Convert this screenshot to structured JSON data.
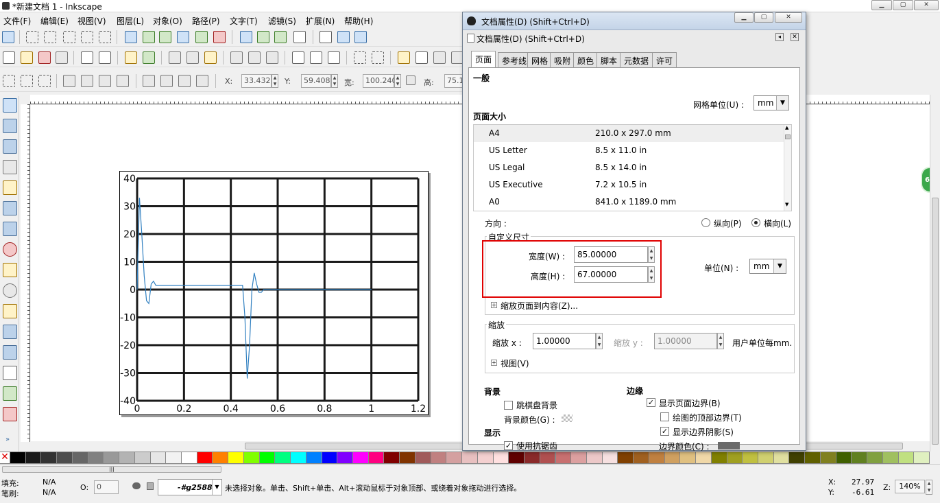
{
  "window": {
    "title": "*新建文档 1 - Inkscape"
  },
  "menubar": [
    "文件(F)",
    "编辑(E)",
    "视图(V)",
    "图层(L)",
    "对象(O)",
    "路径(P)",
    "文字(T)",
    "滤镜(S)",
    "扩展(N)",
    "帮助(H)"
  ],
  "coords_toolbar": {
    "x_label": "X:",
    "x_value": "33.432",
    "y_label": "Y:",
    "y_value": "59.408",
    "w_label": "宽:",
    "w_value": "100.240",
    "h_label": "高:",
    "h_value": "75.1"
  },
  "canvas_chart": {
    "chart_data": {
      "type": "line",
      "title": "",
      "xlabel": "",
      "ylabel": "",
      "xlim": [
        0,
        1.2
      ],
      "ylim": [
        -40,
        40
      ],
      "xticks": [
        "0",
        "0.2",
        "0.4",
        "0.6",
        "0.8",
        "1",
        "1.2"
      ],
      "yticks": [
        "40",
        "30",
        "20",
        "10",
        "0",
        "-10",
        "-20",
        "-30",
        "-40"
      ],
      "grid": true,
      "series": [
        {
          "color": "#2f7fc0",
          "x": [
            0,
            0.01,
            0.02,
            0.03,
            0.04,
            0.05,
            0.06,
            0.07,
            0.08,
            0.09,
            0.1,
            0.12,
            0.15,
            0.2,
            0.3,
            0.4,
            0.45,
            0.46,
            0.47,
            0.48,
            0.49,
            0.5,
            0.51,
            0.52,
            0.53,
            0.54,
            0.55,
            0.6,
            0.8,
            1.0
          ],
          "y": [
            0,
            33,
            20,
            5,
            -4,
            -5,
            2,
            3,
            1.5,
            1.5,
            1.5,
            1.5,
            1.5,
            1.5,
            1.5,
            1.5,
            1.5,
            -10,
            -32,
            -20,
            0,
            6,
            2,
            -1,
            -1,
            0,
            0,
            0,
            0,
            0
          ]
        }
      ]
    }
  },
  "dialog": {
    "title": "文档属性(D) (Shift+Ctrl+D)",
    "inner_title": "文档属性(D) (Shift+Ctrl+D)",
    "tabs": [
      "页面",
      "参考线",
      "网格",
      "吸附",
      "颜色",
      "脚本",
      "元数据",
      "许可"
    ],
    "general_heading": "一般",
    "grid_unit_label": "网格单位(U) :",
    "grid_unit_value": "mm",
    "page_size_heading": "页面大小",
    "page_sizes": [
      {
        "name": "A4",
        "size": "210.0 x 297.0 mm"
      },
      {
        "name": "US Letter",
        "size": "8.5 x 11.0 in"
      },
      {
        "name": "US Legal",
        "size": "8.5 x 14.0 in"
      },
      {
        "name": "US Executive",
        "size": "7.2 x 10.5 in"
      },
      {
        "name": "A0",
        "size": "841.0 x 1189.0 mm"
      }
    ],
    "orientation_label": "方向 :",
    "portrait_label": "纵向(P)",
    "landscape_label": "横向(L)",
    "custom_size_heading": "自定义尺寸",
    "width_label": "宽度(W) :",
    "width_value": "85.00000",
    "height_label": "高度(H) :",
    "height_value": "67.00000",
    "units_label": "单位(N) :",
    "units_value": "mm",
    "resize_label": "缩放页面到内容(Z)...",
    "scale_heading": "缩放",
    "scale_x_label": "缩放 x :",
    "scale_x_value": "1.00000",
    "scale_y_label": "缩放 y :",
    "scale_y_value": "1.00000",
    "user_units_label": "用户单位每mm.",
    "viewbox_label": "视图(V)",
    "background_heading": "背景",
    "checkerboard_label": "跳棋盘背景",
    "bg_color_label": "背景颜色(G) :",
    "display_heading": "显示",
    "antialias_label": "使用抗锯齿",
    "border_heading": "边缘",
    "show_border_label": "显示页面边界(B)",
    "border_on_top_label": "绘图的顶部边界(T)",
    "border_shadow_label": "显示边界阴影(S)",
    "border_color_label": "边界颜色(C) :"
  },
  "status": {
    "fill_label": "填充:",
    "fill_value": "N/A",
    "stroke_label": "笔刷:",
    "stroke_value": "N/A",
    "opacity_label": "O:",
    "opacity_value": "0",
    "layer_value": "-#g2588",
    "message": "未选择对象。单击、Shift+单击、Alt+滚动鼠标于对象顶部、或绕着对象拖动进行选择。",
    "x_label": "X:",
    "x_value": "27.97",
    "y_label": "Y:",
    "y_value": "-6.61",
    "zoom_label": "Z:",
    "zoom_value": "140%"
  },
  "colors": {
    "accent_red": "#e00000",
    "selection_blue": "#2f7fc0",
    "palette": [
      "#000000",
      "#1a1a1a",
      "#333333",
      "#4d4d4d",
      "#666666",
      "#808080",
      "#999999",
      "#b3b3b3",
      "#cccccc",
      "#e6e6e6",
      "#f2f2f2",
      "#ffffff",
      "#ff0000",
      "#ff8000",
      "#ffff00",
      "#80ff00",
      "#00ff00",
      "#00ff80",
      "#00ffff",
      "#0080ff",
      "#0000ff",
      "#8000ff",
      "#ff00ff",
      "#ff0080",
      "#800000",
      "#803300",
      "#a05a5a",
      "#c08080",
      "#d4a0a0",
      "#e8c0c0",
      "#f4d0d0",
      "#ffe0e0",
      "#600000",
      "#8a2a2a",
      "#b05050",
      "#c87070",
      "#dca0a0",
      "#ecc8c8",
      "#f6e0e0",
      "#804000",
      "#a06020",
      "#c08040",
      "#d0a060",
      "#e0c080",
      "#f0d8a8",
      "#808000",
      "#a0a020",
      "#c0c040",
      "#d0d070",
      "#e0e0a0",
      "#404000",
      "#606000",
      "#808020",
      "#406000",
      "#608020",
      "#80a040",
      "#a0c060",
      "#c0e080",
      "#e0f0c0"
    ]
  }
}
